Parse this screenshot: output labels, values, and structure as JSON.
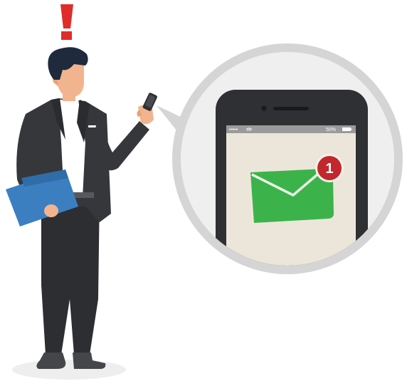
{
  "status_bar": {
    "signal_dots": "•••••",
    "battery_percent": "50%"
  },
  "notification": {
    "badge_count": "1"
  },
  "colors": {
    "alert_red": "#e02b2b",
    "suit": "#35373b",
    "folder_blue": "#3b7fc0",
    "skin": "#f1b48e",
    "envelope_green": "#3bb34a",
    "badge_red": "#c1272d",
    "magnifier_ring": "#d5d5d5",
    "phone_body": "#2f3033",
    "screen_bg": "#ece6da"
  },
  "icons": {
    "alert": "exclamation-icon",
    "mail": "envelope-icon",
    "wifi": "wifi-icon",
    "battery": "battery-icon"
  }
}
